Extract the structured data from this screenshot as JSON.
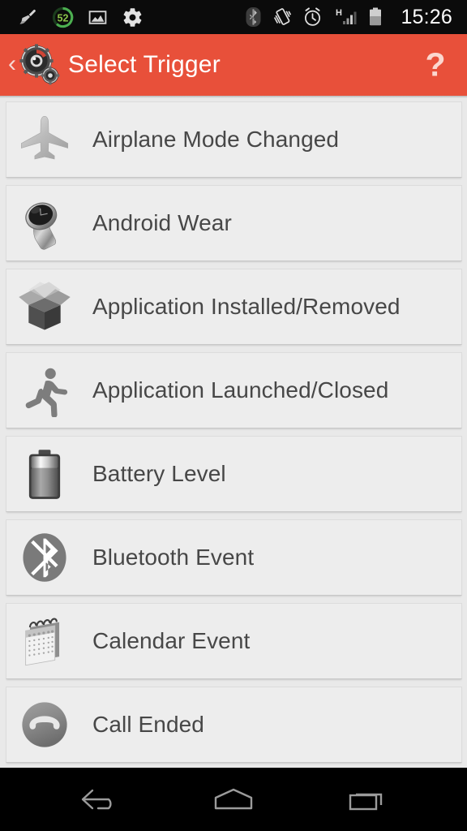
{
  "status_bar": {
    "time": "15:26",
    "left_icons": [
      "broom-cleaner-icon",
      "storage-percent-icon",
      "gallery-image-icon",
      "settings-gear-icon"
    ],
    "storage_percent": "52",
    "right_icons": [
      "bluetooth-icon",
      "vibrate-icon",
      "alarm-clock-icon",
      "hspa-signal-icon",
      "battery-icon"
    ],
    "network_type": "H"
  },
  "header": {
    "title": "Select Trigger",
    "back_label": "‹",
    "help_label": "?",
    "app_icon": "gears-app-icon",
    "background_color": "#e8503a"
  },
  "list": {
    "items": [
      {
        "label": "Airplane Mode Changed",
        "icon": "airplane-icon"
      },
      {
        "label": "Android Wear",
        "icon": "smartwatch-icon"
      },
      {
        "label": "Application Installed/Removed",
        "icon": "open-box-icon"
      },
      {
        "label": "Application Launched/Closed",
        "icon": "running-person-icon"
      },
      {
        "label": "Battery Level",
        "icon": "battery-icon"
      },
      {
        "label": "Bluetooth Event",
        "icon": "bluetooth-icon"
      },
      {
        "label": "Calendar Event",
        "icon": "calendar-icon"
      },
      {
        "label": "Call Ended",
        "icon": "call-ended-icon"
      }
    ]
  },
  "nav_bar": {
    "buttons": [
      {
        "name": "back",
        "icon": "back-arrow-icon"
      },
      {
        "name": "home",
        "icon": "home-icon"
      },
      {
        "name": "recents",
        "icon": "recents-icon"
      }
    ]
  },
  "colors": {
    "accent": "#e8503a",
    "row_background": "#ededed",
    "page_background": "#e9e9e9",
    "text": "#474747"
  }
}
